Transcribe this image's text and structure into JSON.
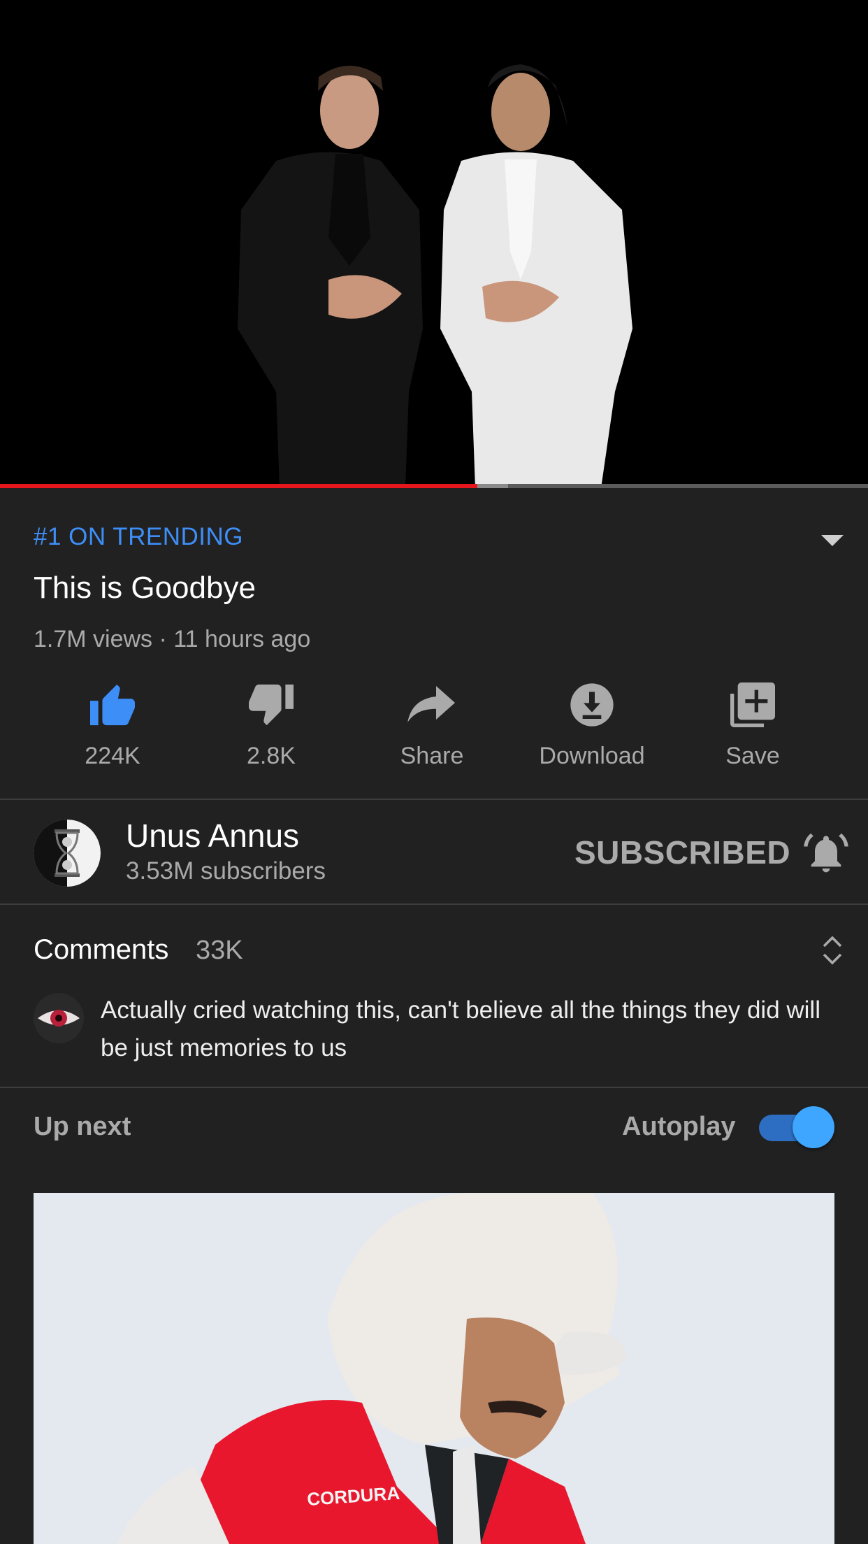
{
  "player": {
    "progress_played": 0.55,
    "progress_buffered": 0.585
  },
  "video": {
    "badge": "#1 ON TRENDING",
    "title": "This is Goodbye",
    "meta": "1.7M views · 11 hours ago"
  },
  "actions": [
    {
      "label": "224K",
      "icon": "thumbs-up-icon",
      "active": true
    },
    {
      "label": "2.8K",
      "icon": "thumbs-down-icon",
      "active": false
    },
    {
      "label": "Share",
      "icon": "share-icon",
      "active": false
    },
    {
      "label": "Download",
      "icon": "download-icon",
      "active": false
    },
    {
      "label": "Save",
      "icon": "add-to-playlist-icon",
      "active": false
    }
  ],
  "channel": {
    "name": "Unus Annus",
    "subscribers": "3.53M subscribers",
    "subscribe_state": "SUBSCRIBED",
    "bell_icon": "notification-bell-icon"
  },
  "comments": {
    "label": "Comments",
    "count": "33K",
    "top_comment": "Actually cried watching this, can't believe all the things they did will be just memories to us"
  },
  "up_next": {
    "label": "Up next",
    "autoplay_label": "Autoplay",
    "autoplay_on": true
  },
  "colors": {
    "background": "#212121",
    "accent_blue": "#3e8ef7",
    "progress_red": "#e5171d",
    "secondary_text": "#aaaaaa"
  }
}
